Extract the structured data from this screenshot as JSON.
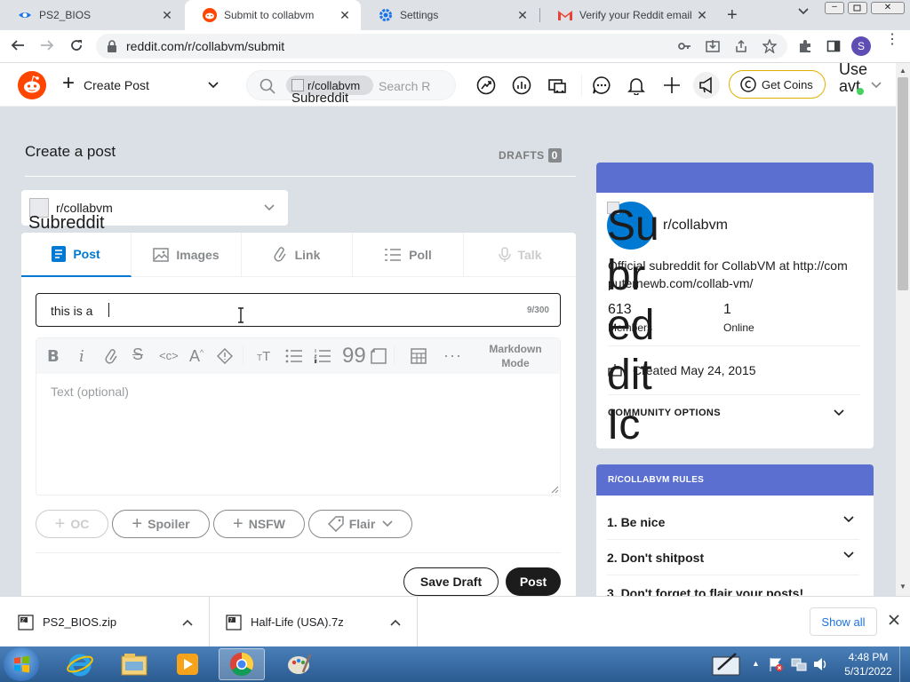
{
  "browser": {
    "tabs": [
      {
        "title": "PS2_BIOS",
        "active": false
      },
      {
        "title": "Submit to collabvm",
        "active": true
      },
      {
        "title": "Settings",
        "active": false
      },
      {
        "title": "Verify your Reddit email a",
        "active": false
      }
    ],
    "url": "reddit.com/r/collabvm/submit",
    "profile_initial": "S"
  },
  "reddit_header": {
    "create_post_label": "Create Post",
    "search_chip": "r/collabvm",
    "search_chip_alt": "Subreddit Icon",
    "search_placeholder": "Search R",
    "get_coins_label": "Get Coins",
    "user_label": "Use",
    "user_sub": "avt"
  },
  "form": {
    "heading": "Create a post",
    "drafts_label": "DRAFTS",
    "drafts_count": "0",
    "community_name": "r/collabvm",
    "community_icon_alt": "Subreddit Icon",
    "tabs": [
      "Post",
      "Images",
      "Link",
      "Poll",
      "Talk"
    ],
    "title_value": "this is a",
    "title_counter": "9/300",
    "markdown_mode_line1": "Markdown",
    "markdown_mode_line2": "Mode",
    "text_placeholder": "Text (optional)",
    "flags": [
      "OC",
      "Spoiler",
      "NSFW",
      "Flair"
    ],
    "save_draft_label": "Save Draft",
    "post_label": "Post"
  },
  "sidebar": {
    "community_name": "r/collabvm",
    "icon_alt": "Subreddit Icon",
    "description": "Official subreddit for CollabVM at http://computernewb.com/collab-vm/",
    "members_value": "613",
    "members_label": "Members",
    "online_value": "1",
    "online_label": "Online",
    "created": "Created May 24, 2015",
    "community_options": "COMMUNITY OPTIONS",
    "rules_title": "R/COLLABVM RULES",
    "rules": [
      "1. Be nice",
      "2. Don't shitpost",
      "3. Don't forget to flair your posts!"
    ]
  },
  "downloads": {
    "items": [
      "PS2_BIOS.zip",
      "Half-Life (USA).7z"
    ],
    "show_all_label": "Show all"
  },
  "taskbar": {
    "time": "4:48 PM",
    "date": "5/31/2022"
  },
  "colors": {
    "reddit_orange": "#ff4500",
    "reddit_blue": "#0079d3",
    "sidebar_banner": "#5a6fd0",
    "post_button": "#1c1c1c",
    "coins_border": "#e0b000"
  }
}
